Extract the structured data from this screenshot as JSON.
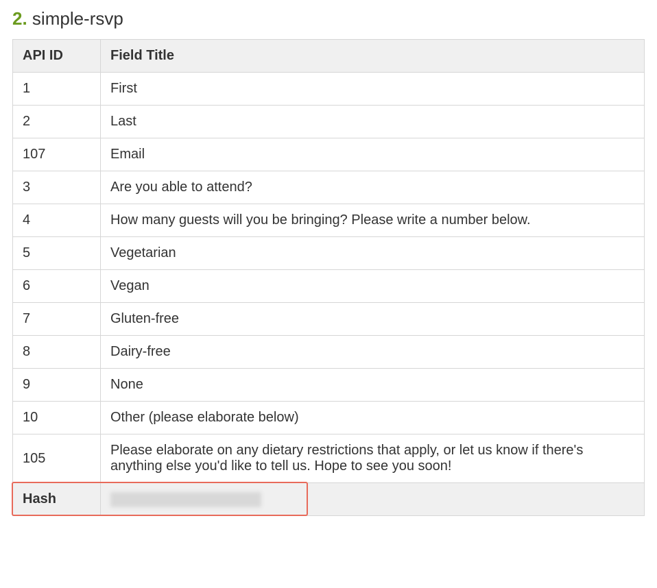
{
  "heading": {
    "number": "2.",
    "name": "simple-rsvp"
  },
  "table": {
    "headers": {
      "api_id": "API ID",
      "field_title": "Field Title"
    },
    "rows": [
      {
        "api_id": "1",
        "field_title": "First"
      },
      {
        "api_id": "2",
        "field_title": "Last"
      },
      {
        "api_id": "107",
        "field_title": "Email"
      },
      {
        "api_id": "3",
        "field_title": "Are you able to attend?"
      },
      {
        "api_id": "4",
        "field_title": "How many guests will you be bringing? Please write a number below."
      },
      {
        "api_id": "5",
        "field_title": "Vegetarian"
      },
      {
        "api_id": "6",
        "field_title": "Vegan"
      },
      {
        "api_id": "7",
        "field_title": "Gluten-free"
      },
      {
        "api_id": "8",
        "field_title": "Dairy-free"
      },
      {
        "api_id": "9",
        "field_title": "None"
      },
      {
        "api_id": "10",
        "field_title": "Other (please elaborate below)"
      },
      {
        "api_id": "105",
        "field_title": "Please elaborate on any dietary restrictions that apply, or let us know if there's anything else you'd like to tell us. Hope to see you soon!"
      }
    ],
    "hash": {
      "label": "Hash",
      "value_redacted": true
    }
  }
}
